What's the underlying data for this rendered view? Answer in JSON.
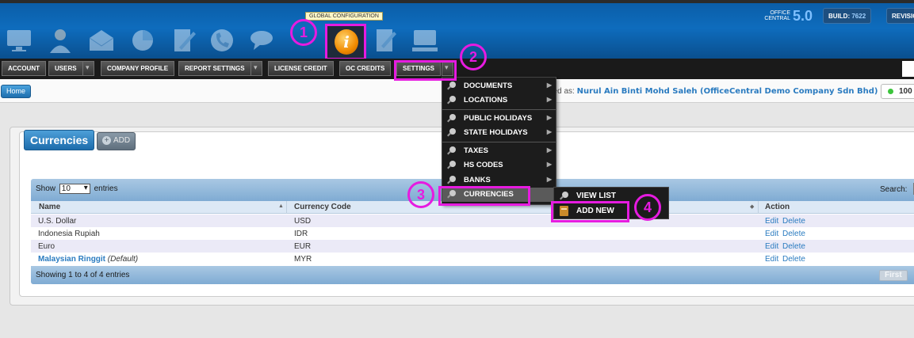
{
  "header": {
    "tooltip": "GLOBAL CONFIGURATION",
    "logo_line1": "OFFICE",
    "logo_line2": "CENTRAL",
    "version": "5.0",
    "build_label": "BUILD:",
    "build_value": "7622",
    "revision_label": "REVISION",
    "app_icons": [
      "monitor-icon",
      "user-icon",
      "mail-icon",
      "pie-chart-icon",
      "document-edit-icon",
      "phone-icon",
      "chat-icon",
      "global-configuration-icon",
      "notes-icon",
      "computer-icon"
    ]
  },
  "nav": {
    "items": [
      "ACCOUNT",
      "USERS",
      "COMPANY PROFILE",
      "REPORT SETTINGS",
      "LICENSE CREDIT",
      "OC CREDITS",
      "SETTINGS"
    ]
  },
  "toolbar": {
    "home": "Home",
    "logged_prefix": "ged as:",
    "logged_user": "Nurul Ain Binti Mohd Saleh (OfficeCentral Demo Company Sdn Bhd)",
    "status": "100"
  },
  "page": {
    "title": "Currencies",
    "add_label": "ADD"
  },
  "table": {
    "show_prefix": "Show",
    "show_value": "10",
    "show_suffix": "entries",
    "search_label": "Search:",
    "columns": [
      "Name",
      "Currency Code",
      "Action"
    ],
    "rows": [
      {
        "name": "U.S. Dollar",
        "code": "USD",
        "edit": "Edit",
        "delete": "Delete"
      },
      {
        "name": "Indonesia Rupiah",
        "code": "IDR",
        "edit": "Edit",
        "delete": "Delete"
      },
      {
        "name": "Euro",
        "code": "EUR",
        "edit": "Edit",
        "delete": "Delete"
      },
      {
        "name": "Malaysian Ringgit",
        "default_tag": "(Default)",
        "code": "MYR",
        "edit": "Edit",
        "delete": "Delete"
      }
    ],
    "footer": "Showing 1 to 4 of 4 entries",
    "first": "First",
    "next_partial": "P"
  },
  "menu": {
    "items": [
      "DOCUMENTS",
      "LOCATIONS",
      "PUBLIC HOLIDAYS",
      "STATE HOLIDAYS",
      "TAXES",
      "HS CODES",
      "BANKS",
      "CURRENCIES"
    ],
    "submenu": [
      "VIEW LIST",
      "ADD NEW"
    ]
  },
  "annotations": [
    "1",
    "2",
    "3",
    "4"
  ],
  "colors": {
    "highlight": "#e61be0",
    "header_blue": "#0e6cbd",
    "link": "#2a7bc0"
  }
}
